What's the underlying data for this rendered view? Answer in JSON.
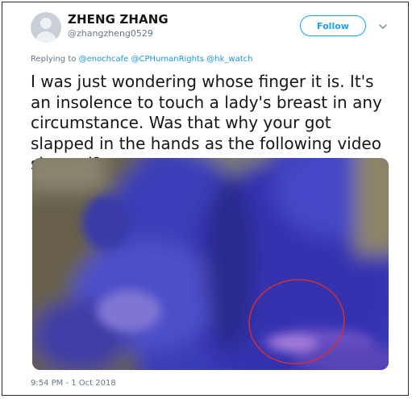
{
  "tweet": {
    "author_name": "ZHENG ZHANG",
    "author_handle": "@zhangzheng0529",
    "follow_label": "Follow",
    "reply_prefix": "Replying to",
    "reply_mentions": "@enochcafe @CPHumanRights @hk_watch",
    "text": "I was just wondering whose finger it is. It's an insolence to touch a lady's breast in any circumstance. Was that why your got slapped in the hands as the following video showed?",
    "timestamp": "9:54 PM - 1 Oct 2018"
  },
  "icons": {
    "avatar": "default-avatar-icon",
    "caret": "chevron-down-icon"
  },
  "colors": {
    "accent": "#1da1f2",
    "link": "#1b95e0",
    "secondary_text": "#657786",
    "primary_text": "#14171a",
    "annotation_circle": "#d9302c"
  }
}
